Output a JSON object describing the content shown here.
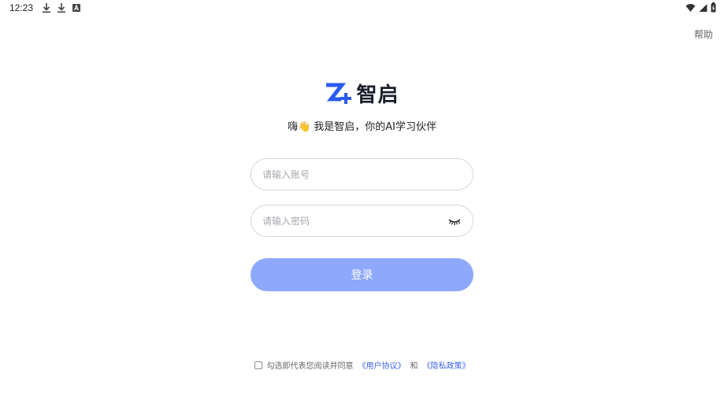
{
  "status_bar": {
    "time": "12:23",
    "left_icons": [
      "download-icon",
      "download-icon",
      "accessibility-icon"
    ],
    "right_icons": [
      "wifi-icon",
      "signal-icon",
      "battery-icon"
    ]
  },
  "header": {
    "help_label": "帮助"
  },
  "brand": {
    "name": "智启",
    "logo_icon": "zhiqi-logo-icon",
    "accent_color": "#2a5bf0"
  },
  "tagline": "嗨👋 我是智启，你的AI学习伙伴",
  "form": {
    "account_placeholder": "请输入账号",
    "account_value": "",
    "password_placeholder": "请输入密码",
    "password_value": "",
    "password_toggle_icon": "eye-closed-icon",
    "login_label": "登录",
    "login_color": "#8ea8fb"
  },
  "agreement": {
    "checked": false,
    "prefix": "勾选即代表您阅读并同意",
    "user_agreement": "《用户协议》",
    "conjunction": "和",
    "privacy_policy": "《隐私政策》"
  }
}
